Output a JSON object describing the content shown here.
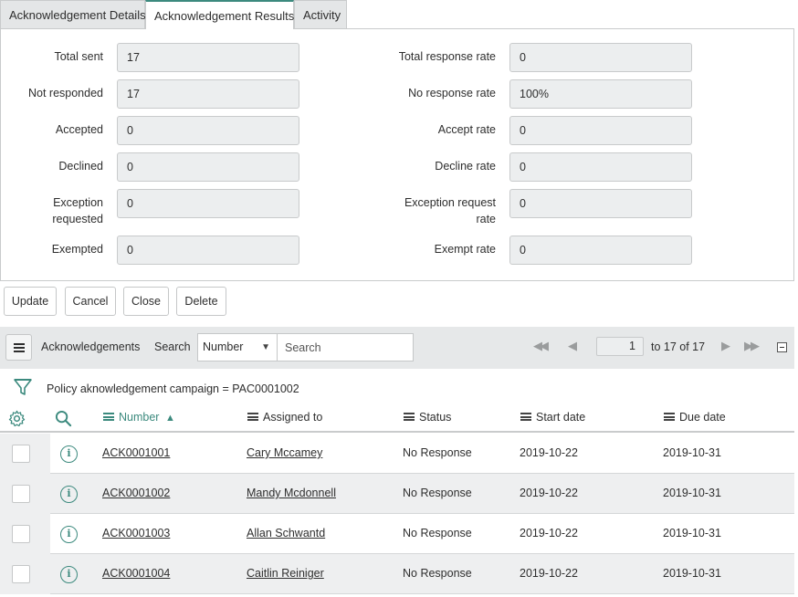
{
  "tabs": [
    "Acknowledgement Details",
    "Acknowledgement Results",
    "Activity"
  ],
  "fields_left": [
    {
      "label": "Total sent",
      "value": "17"
    },
    {
      "label": "Not responded",
      "value": "17"
    },
    {
      "label": "Accepted",
      "value": "0"
    },
    {
      "label": "Declined",
      "value": "0"
    },
    {
      "label_line1": "Exception",
      "label_line2": "requested",
      "value": "0"
    },
    {
      "label": "Exempted",
      "value": "0"
    }
  ],
  "fields_right": [
    {
      "label": "Total response rate",
      "value": "0"
    },
    {
      "label": "No response rate",
      "value": "100%"
    },
    {
      "label": "Accept rate",
      "value": "0"
    },
    {
      "label": "Decline rate",
      "value": "0"
    },
    {
      "label_line1": "Exception request",
      "label_line2": "rate",
      "value": "0"
    },
    {
      "label": "Exempt rate",
      "value": "0"
    }
  ],
  "buttons": {
    "update": "Update",
    "cancel": "Cancel",
    "close": "Close",
    "delete": "Delete"
  },
  "list": {
    "title": "Acknowledgements",
    "search_label": "Search",
    "search_field": "Number",
    "search_placeholder": "Search",
    "page_value": "1",
    "page_text": "to 17 of 17",
    "filter": "Policy aknowledgement campaign = PAC0001002",
    "columns": [
      "Number",
      "Assigned to",
      "Status",
      "Start date",
      "Due date"
    ],
    "sort_indicator": "▲",
    "rows": [
      {
        "number": "ACK0001001",
        "assigned_to": "Cary Mccamey",
        "status": "No Response",
        "start": "2019-10-22",
        "due": "2019-10-31"
      },
      {
        "number": "ACK0001002",
        "assigned_to": "Mandy Mcdonnell",
        "status": "No Response",
        "start": "2019-10-22",
        "due": "2019-10-31"
      },
      {
        "number": "ACK0001003",
        "assigned_to": "Allan Schwantd",
        "status": "No Response",
        "start": "2019-10-22",
        "due": "2019-10-31"
      },
      {
        "number": "ACK0001004",
        "assigned_to": "Caitlin Reiniger",
        "status": "No Response",
        "start": "2019-10-22",
        "due": "2019-10-31"
      }
    ]
  },
  "colors": {
    "accent": "#3c8a7e",
    "field_bg": "#eceeef",
    "listbar_bg": "#e6e8e9"
  }
}
